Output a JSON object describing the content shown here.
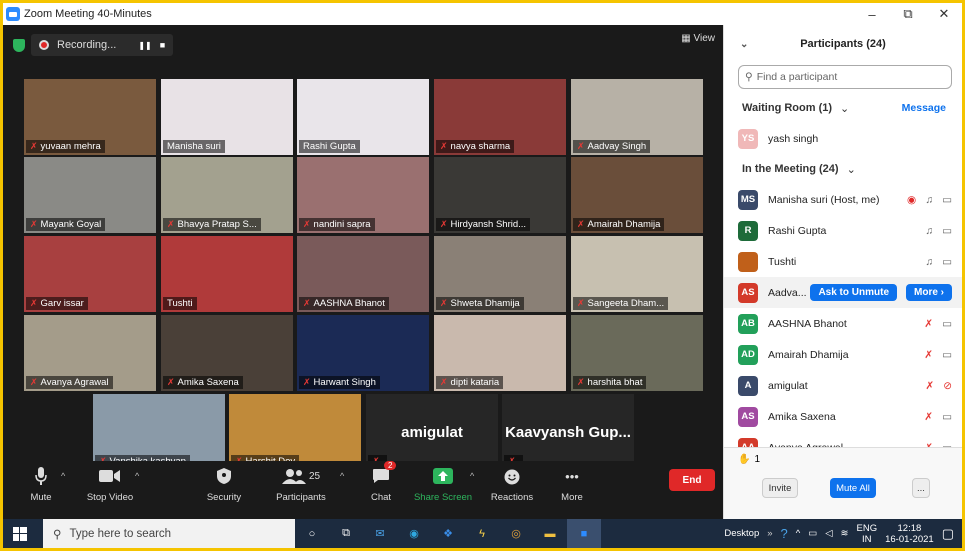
{
  "window": {
    "title": "Zoom Meeting 40-Minutes",
    "controls": [
      "–",
      "⧉",
      "✕"
    ]
  },
  "recording": {
    "label": "Recording...",
    "pause": "❚❚",
    "stop": "■"
  },
  "view_label": "View",
  "tiles": [
    {
      "name": "yuvaan mehra",
      "muted": true,
      "bg": "#7a5a3e"
    },
    {
      "name": "Manisha suri",
      "muted": false,
      "bg": "#e8e2e6"
    },
    {
      "name": "Rashi Gupta",
      "muted": false,
      "bg": "#e9e5ea",
      "active": true
    },
    {
      "name": "navya sharma",
      "muted": true,
      "bg": "#8a3a38"
    },
    {
      "name": "Aadvay Singh",
      "muted": true,
      "bg": "#b7b1a6"
    },
    {
      "name": "Mayank Goyal",
      "muted": true,
      "bg": "#8a8a86"
    },
    {
      "name": "Bhavya Pratap S...",
      "muted": true,
      "bg": "#a3a18f"
    },
    {
      "name": "nandini sapra",
      "muted": true,
      "bg": "#9a7070"
    },
    {
      "name": "Hirdyansh Shrid...",
      "muted": true,
      "bg": "#3a3936"
    },
    {
      "name": "Amairah Dhamija",
      "muted": true,
      "bg": "#6a4e3a"
    },
    {
      "name": "Garv issar",
      "muted": true,
      "bg": "#a84040"
    },
    {
      "name": "Tushti",
      "muted": false,
      "bg": "#b03a3a"
    },
    {
      "name": "AASHNA Bhanot",
      "muted": true,
      "bg": "#7a5a5a"
    },
    {
      "name": "Shweta Dhamija",
      "muted": true,
      "bg": "#8a8076"
    },
    {
      "name": "Sangeeta Dham...",
      "muted": true,
      "bg": "#c7c0b0"
    },
    {
      "name": "Avanya Agrawal",
      "muted": true,
      "bg": "#a49c8a"
    },
    {
      "name": "Amika Saxena",
      "muted": true,
      "bg": "#4a4038"
    },
    {
      "name": "Harwant Singh",
      "muted": true,
      "bg": "#1b2a55"
    },
    {
      "name": "dipti kataria",
      "muted": true,
      "bg": "#c9b9ad"
    },
    {
      "name": "harshita bhat",
      "muted": true,
      "bg": "#6a6a5a"
    },
    {
      "name": "Vanshika kashyap",
      "muted": true,
      "bg": "#8a9aa8"
    },
    {
      "name": "Harshit Dey",
      "muted": true,
      "bg": "#c08a3a"
    },
    {
      "name": "amigulat",
      "muted": true,
      "bg": "#262626",
      "text_only": true
    },
    {
      "name": "Kaavyansh Gup...",
      "muted": true,
      "bg": "#262626",
      "text_only": true
    }
  ],
  "toolbar": {
    "mute": "Mute",
    "stop_video": "Stop Video",
    "security": "Security",
    "participants": "Participants",
    "participants_count": "25",
    "chat": "Chat",
    "chat_badge": "2",
    "share_screen": "Share Screen",
    "reactions": "Reactions",
    "more": "More",
    "more_glyph": "•••",
    "end": "End"
  },
  "panel": {
    "title": "Participants (24)",
    "search_placeholder": "Find a participant",
    "waiting_room": "Waiting Room (1)",
    "message": "Message",
    "waiting": [
      {
        "initials": "YS",
        "name": "yash singh",
        "color": "#f0b8b8"
      }
    ],
    "in_meeting": "In the Meeting (24)",
    "participants": [
      {
        "initials": "MS",
        "name": "Manisha suri (Host, me)",
        "color": "#3a4a6a",
        "state": "recording"
      },
      {
        "initials": "R",
        "name": "Rashi Gupta",
        "color": "#1e6b3a",
        "state": "on"
      },
      {
        "initials": "",
        "name": "Tushti",
        "color": "#c0601a",
        "state": "on"
      },
      {
        "initials": "AS",
        "name": "Aadva...",
        "color": "#d33a2a",
        "state": "actions"
      },
      {
        "initials": "AB",
        "name": "AASHNA Bhanot",
        "color": "#22a05a",
        "state": "muted"
      },
      {
        "initials": "AD",
        "name": "Amairah Dhamija",
        "color": "#22a05a",
        "state": "muted"
      },
      {
        "initials": "A",
        "name": "amigulat",
        "color": "#3a4a6a",
        "state": "muted-novideo"
      },
      {
        "initials": "AS",
        "name": "Amika Saxena",
        "color": "#a04aa0",
        "state": "muted"
      },
      {
        "initials": "AA",
        "name": "Avanya Agrawal",
        "color": "#d33a2a",
        "state": "muted"
      }
    ],
    "ask_unmute": "Ask to Unmute",
    "more": "More ›",
    "raise_count": "1",
    "invite": "Invite",
    "mute_all": "Mute All",
    "more_dots": "..."
  },
  "taskbar": {
    "search_placeholder": "Type here to search",
    "desktop": "Desktop",
    "lang": "ENG",
    "region": "IN",
    "time": "12:18",
    "date": "16-01-2021"
  },
  "colors": {
    "accent": "#0e72ed",
    "end": "#e02828",
    "share": "#2db55d",
    "mute_red": "#e53935"
  }
}
